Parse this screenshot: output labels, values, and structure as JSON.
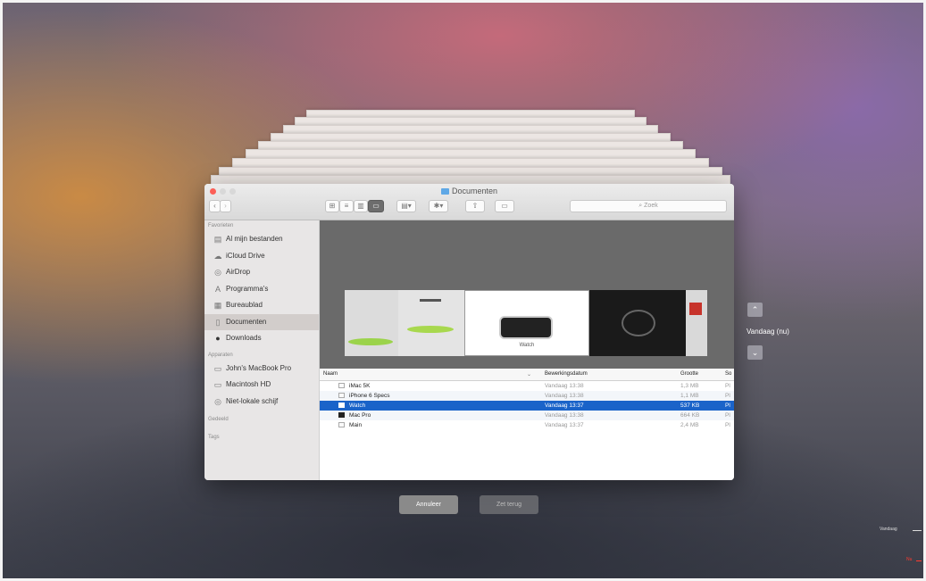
{
  "window": {
    "title": "Documenten",
    "search_placeholder": "Zoek"
  },
  "toolbar": {
    "back_icon": "chevron-left-icon",
    "forward_icon": "chevron-right-icon",
    "view_buttons": [
      "icon-view-icon",
      "list-view-icon",
      "column-view-icon",
      "cover-flow-icon"
    ],
    "arrange_icon": "arrange-icon",
    "action_icon": "gear-icon",
    "share_icon": "share-icon",
    "tag_icon": "tag-icon"
  },
  "sidebar": {
    "favorites_heading": "Favorieten",
    "favorites": [
      {
        "label": "Al mijn bestanden",
        "icon": "all-files-icon"
      },
      {
        "label": "iCloud Drive",
        "icon": "cloud-icon"
      },
      {
        "label": "AirDrop",
        "icon": "airdrop-icon"
      },
      {
        "label": "Programma's",
        "icon": "applications-icon"
      },
      {
        "label": "Bureaublad",
        "icon": "desktop-icon"
      },
      {
        "label": "Documenten",
        "icon": "documents-icon"
      },
      {
        "label": "Downloads",
        "icon": "download-icon"
      }
    ],
    "devices_heading": "Apparaten",
    "devices": [
      {
        "label": "John's MacBook Pro",
        "icon": "laptop-icon"
      },
      {
        "label": "Macintosh HD",
        "icon": "harddisk-icon"
      },
      {
        "label": "Niet-lokale schijf",
        "icon": "disc-icon"
      }
    ],
    "shared_heading": "Gedeeld",
    "tags_heading": "Tags"
  },
  "preview": {
    "center_caption": "Watch"
  },
  "file_list": {
    "columns": [
      "Naam",
      "Bewerkingsdatum",
      "Grootte",
      "So"
    ],
    "rows": [
      {
        "name": "iMac 5K",
        "date": "Vandaag 13:38",
        "size": "1,3 MB",
        "kind": "Pl"
      },
      {
        "name": "iPhone 6 Specs",
        "date": "Vandaag 13:38",
        "size": "1,1 MB",
        "kind": "Pl"
      },
      {
        "name": "Watch",
        "date": "Vandaag 13:37",
        "size": "537 KB",
        "kind": "Pl"
      },
      {
        "name": "Mac Pro",
        "date": "Vandaag 13:38",
        "size": "664 KB",
        "kind": "Pl"
      },
      {
        "name": "Main",
        "date": "Vandaag 13:37",
        "size": "2,4 MB",
        "kind": "Pl"
      }
    ],
    "selected_index": 2
  },
  "timeline_nav": {
    "up_icon": "chevron-up-icon",
    "down_icon": "chevron-down-icon",
    "current_label": "Vandaag (nu)"
  },
  "buttons": {
    "cancel": "Annuleer",
    "restore": "Zet terug"
  },
  "timeline": {
    "today_label": "Vandaag",
    "now_label": "Nu"
  },
  "colors": {
    "selection": "#1a63c9",
    "close": "#fc5f57",
    "minimize": "#d8d8d8",
    "zoom": "#d8d8d8",
    "now_marker": "#ff3b30"
  }
}
